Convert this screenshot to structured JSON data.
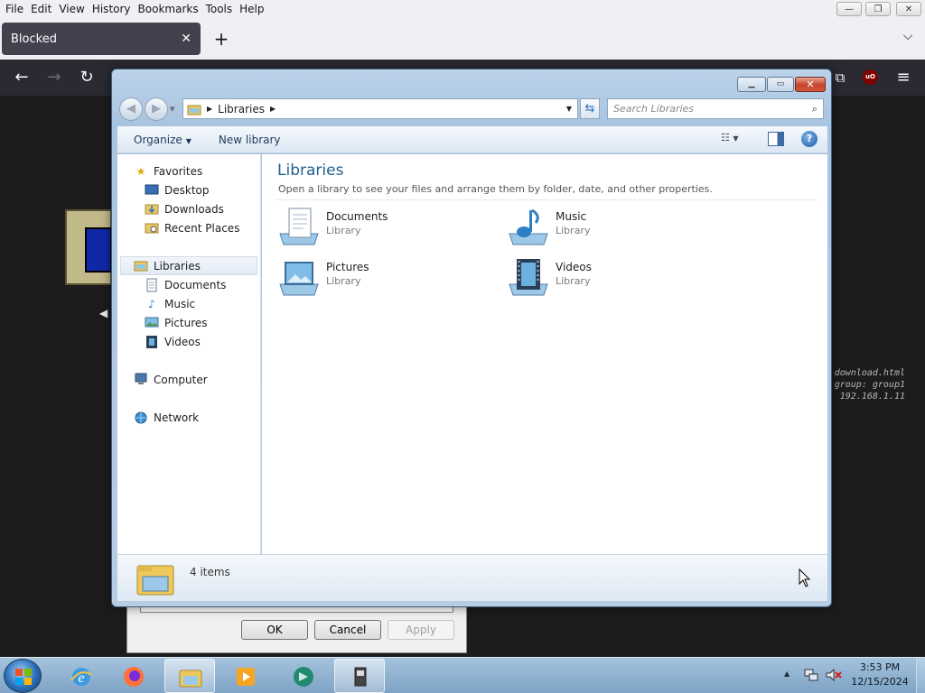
{
  "browser": {
    "menu": [
      "File",
      "Edit",
      "View",
      "History",
      "Bookmarks",
      "Tools",
      "Help"
    ],
    "tab_title": "Blocked",
    "tab_close": "✕",
    "new_tab": "+",
    "tab_list": "⌵",
    "win_min": "—",
    "win_restore": "❐",
    "win_close": "✕",
    "ublock": "uO",
    "extensions_icon": "puzzle-icon",
    "menu_icon": "hamburger-icon"
  },
  "background_page": {
    "info_lines": [
      "download.html",
      "group: group1",
      "192.168.1.11"
    ],
    "dialog_buttons": {
      "ok": "OK",
      "cancel": "Cancel",
      "apply": "Apply"
    }
  },
  "explorer": {
    "address_crumb": "Libraries",
    "search_placeholder": "Search Libraries",
    "commands": {
      "organize": "Organize",
      "new_library": "New library"
    },
    "nav": {
      "favorites": "Favorites",
      "desktop": "Desktop",
      "downloads": "Downloads",
      "recent": "Recent Places",
      "libraries": "Libraries",
      "documents": "Documents",
      "music": "Music",
      "pictures": "Pictures",
      "videos": "Videos",
      "computer": "Computer",
      "network": "Network"
    },
    "main": {
      "title": "Libraries",
      "subtitle": "Open a library to see your files and arrange them by folder, date, and other properties.",
      "libraries": [
        {
          "name": "Documents",
          "type": "Library"
        },
        {
          "name": "Music",
          "type": "Library"
        },
        {
          "name": "Pictures",
          "type": "Library"
        },
        {
          "name": "Videos",
          "type": "Library"
        }
      ]
    },
    "status": {
      "count": "4 items"
    }
  },
  "taskbar": {
    "time": "3:53 PM",
    "date": "12/15/2024",
    "tray_arrow": "▲"
  },
  "colors": {
    "accent": "#1e5f8e",
    "taskbar": "#8fb0d0",
    "browser_dark": "#2b2a33"
  }
}
